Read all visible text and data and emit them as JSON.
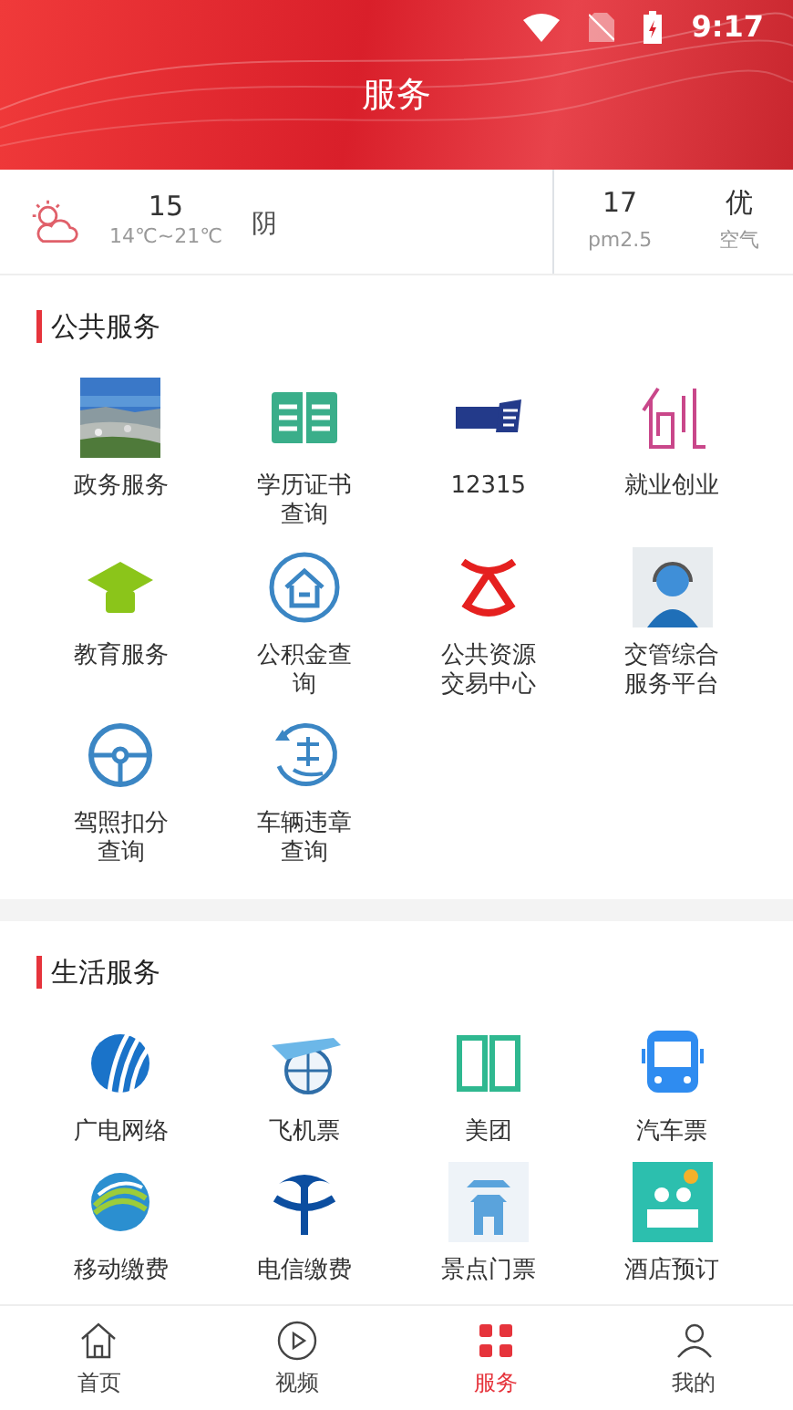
{
  "status_bar": {
    "time": "9:17"
  },
  "header": {
    "title": "服务"
  },
  "weather": {
    "temp": "15",
    "range": "14℃~21℃",
    "condition": "阴",
    "pm_value": "17",
    "pm_label": "pm2.5",
    "air_value": "优",
    "air_label": "空气"
  },
  "sections": [
    {
      "title": "公共服务",
      "items": [
        {
          "label": "政务服务",
          "kind": "picture"
        },
        {
          "label": "学历证书查询",
          "kind": "icon"
        },
        {
          "label": "12315",
          "kind": "icon"
        },
        {
          "label": "就业创业",
          "kind": "icon"
        },
        {
          "label": "教育服务",
          "kind": "icon"
        },
        {
          "label": "公积金查询",
          "kind": "icon"
        },
        {
          "label": "公共资源交易中心",
          "kind": "icon"
        },
        {
          "label": "交管综合服务平台",
          "kind": "icon"
        },
        {
          "label": "驾照扣分查询",
          "kind": "icon"
        },
        {
          "label": "车辆违章查询",
          "kind": "icon"
        }
      ]
    },
    {
      "title": "生活服务",
      "items": [
        {
          "label": "广电网络",
          "kind": "icon"
        },
        {
          "label": "飞机票",
          "kind": "icon"
        },
        {
          "label": "美团",
          "kind": "icon"
        },
        {
          "label": "汽车票",
          "kind": "icon"
        },
        {
          "label": "移动缴费",
          "kind": "icon"
        },
        {
          "label": "电信缴费",
          "kind": "icon"
        },
        {
          "label": "景点门票",
          "kind": "icon"
        },
        {
          "label": "酒店预订",
          "kind": "icon"
        }
      ]
    }
  ],
  "bottom_nav": [
    {
      "label": "首页",
      "selected": false
    },
    {
      "label": "视频",
      "selected": false
    },
    {
      "label": "服务",
      "selected": true
    },
    {
      "label": "我的",
      "selected": false
    }
  ]
}
